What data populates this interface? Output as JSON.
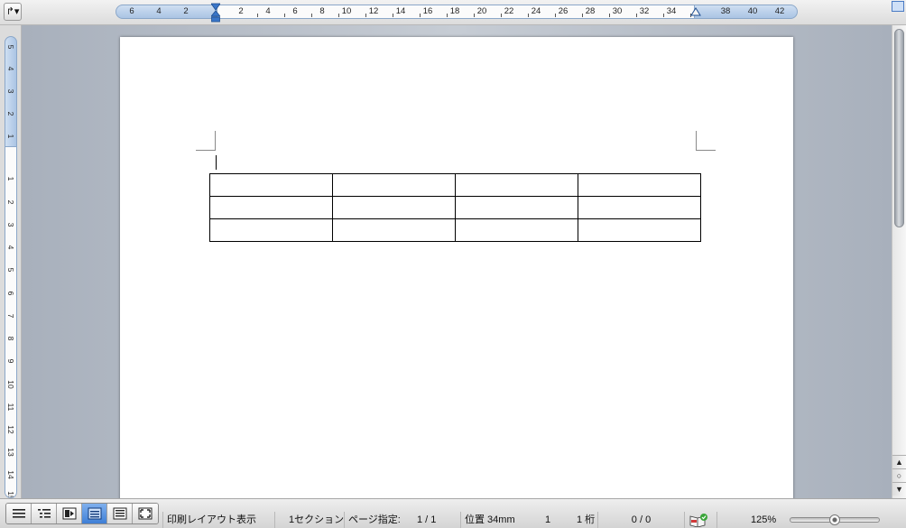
{
  "toolbar": {
    "tab_selector_glyph": "↱▾",
    "tab_selector_icon": "tab-selector-icon"
  },
  "horizontal_ruler": {
    "labels": [
      "6",
      "4",
      "2",
      "2",
      "4",
      "6",
      "8",
      "10",
      "12",
      "14",
      "16",
      "18",
      "20",
      "22",
      "24",
      "26",
      "28",
      "30",
      "32",
      "34",
      "38",
      "40",
      "42"
    ],
    "accent_color": "#3a76c8"
  },
  "vertical_ruler": {
    "labels": [
      "5",
      "4",
      "3",
      "2",
      "1",
      "1",
      "2",
      "3",
      "4",
      "5",
      "6",
      "7",
      "8",
      "9",
      "10",
      "11",
      "12",
      "13",
      "14",
      "15"
    ]
  },
  "document": {
    "table": {
      "rows": 3,
      "columns": 4,
      "cells": [
        [
          "",
          "",
          "",
          ""
        ],
        [
          "",
          "",
          "",
          ""
        ],
        [
          "",
          "",
          "",
          ""
        ]
      ]
    }
  },
  "scrollbar": {
    "prev_glyph": "▲",
    "select_glyph": "○",
    "next_glyph": "▼"
  },
  "status_bar": {
    "view_buttons": [
      {
        "name": "draft-view-button",
        "icon": "draft-view-icon"
      },
      {
        "name": "outline-view-button",
        "icon": "outline-view-icon"
      },
      {
        "name": "publishing-view-button",
        "icon": "publishing-view-icon"
      },
      {
        "name": "print-layout-view-button",
        "icon": "print-layout-view-icon",
        "active": true
      },
      {
        "name": "notebook-view-button",
        "icon": "notebook-view-icon"
      },
      {
        "name": "focus-view-button",
        "icon": "focus-view-icon"
      }
    ],
    "view_mode": "印刷レイアウト表示",
    "section": "1セクション",
    "page_label": "ページ指定:",
    "page_value": "1 / 1",
    "position": "位置 34mm",
    "line": "1",
    "column": "1 桁",
    "word_count": "0 / 0",
    "spell_icon": "spelling-check-icon",
    "zoom": "125%",
    "zoom_fraction": 0.5
  }
}
